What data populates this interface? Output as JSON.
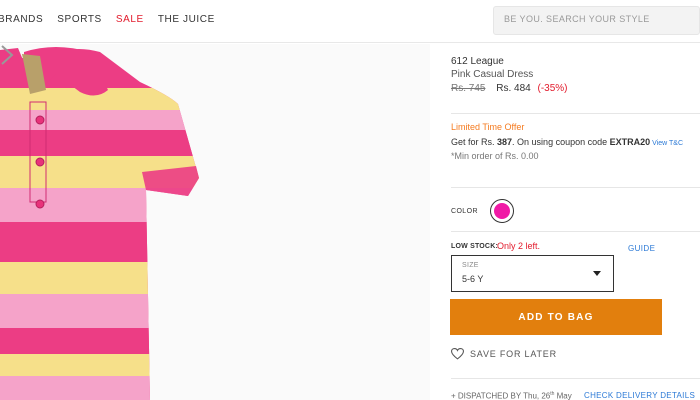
{
  "nav": {
    "items": [
      {
        "label": "BRANDS"
      },
      {
        "label": "SPORTS"
      },
      {
        "label": "SALE"
      },
      {
        "label": "THE JUICE"
      }
    ]
  },
  "search": {
    "placeholder": "BE YOU. SEARCH YOUR STYLE"
  },
  "product": {
    "brand": "612 League",
    "name": "Pink Casual Dress",
    "mrp": "Rs. 745",
    "price": "Rs. 484",
    "discount": "(-35%)"
  },
  "offer": {
    "title": "Limited Time Offer",
    "line_prefix": "Get for Rs. ",
    "line_price": "387",
    "line_mid": ". On using coupon code ",
    "coupon": "EXTRA20",
    "tc_link": "View T&C",
    "min_order": "*Min order of Rs. 0.00"
  },
  "color": {
    "label": "COLOR",
    "selected": "#f019a6"
  },
  "stock": {
    "label": "LOW STOCK:",
    "value": "Only 2 left."
  },
  "size": {
    "guide": "GUIDE",
    "small_label": "SIZE",
    "value": "5-6 Y"
  },
  "actions": {
    "add_to_bag": "ADD TO BAG",
    "save_for_later": "SAVE FOR LATER"
  },
  "delivery": {
    "dispatch_prefix": "+ DISPATCHED BY ",
    "dispatch_day": "Thu, 26",
    "dispatch_sup": "th",
    "dispatch_month": " May",
    "check_link": "CHECK DELIVERY DETAILS"
  },
  "colors": {
    "accent_orange": "#e27f0d",
    "sale_red": "#e21b2c",
    "link_blue": "#2c7ad6",
    "shirt_pink": "#ec3d84",
    "shirt_light_pink": "#f5a3c9",
    "shirt_yellow": "#f6e08a"
  }
}
